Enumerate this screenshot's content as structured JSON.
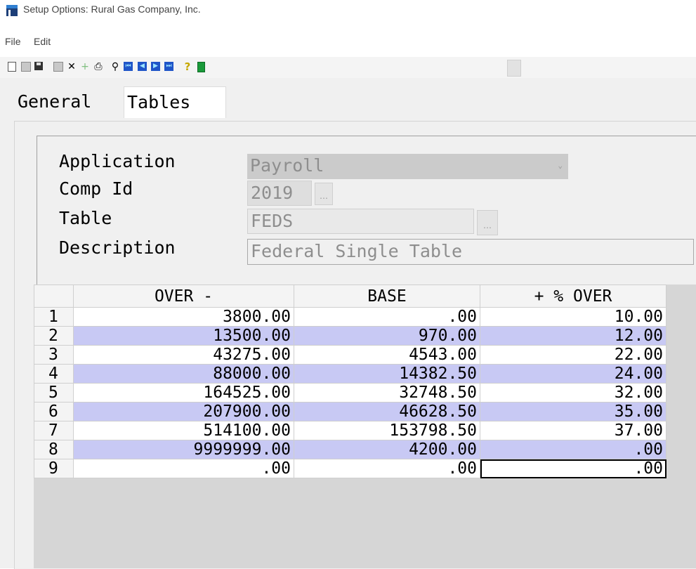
{
  "window": {
    "title": "Setup Options: Rural Gas Company, Inc."
  },
  "menu": {
    "items": [
      "File",
      "Edit"
    ]
  },
  "toolbar": {
    "buttons": [
      "new-icon",
      "copy-icon",
      "save-icon",
      "clear-icon",
      "delete-icon",
      "add-icon",
      "print-icon",
      "find-icon",
      "first-record-icon",
      "previous-record-icon",
      "next-record-icon",
      "last-record-icon",
      "help-icon",
      "exit-icon",
      "options-icon"
    ]
  },
  "tabs": [
    {
      "label": "General",
      "active": false
    },
    {
      "label": "Tables",
      "active": true
    }
  ],
  "form": {
    "application_label": "Application",
    "application_value": "Payroll",
    "compid_label": "Comp Id",
    "compid_value": "2019",
    "table_label": "Table",
    "table_value": "FEDS",
    "description_label": "Description",
    "description_value": "Federal Single Table"
  },
  "grid": {
    "headers": [
      "",
      "OVER -",
      "BASE",
      "+ % OVER"
    ],
    "rows": [
      {
        "n": "1",
        "over": "3800.00",
        "base": ".00",
        "pct": "10.00"
      },
      {
        "n": "2",
        "over": "13500.00",
        "base": "970.00",
        "pct": "12.00"
      },
      {
        "n": "3",
        "over": "43275.00",
        "base": "4543.00",
        "pct": "22.00"
      },
      {
        "n": "4",
        "over": "88000.00",
        "base": "14382.50",
        "pct": "24.00"
      },
      {
        "n": "5",
        "over": "164525.00",
        "base": "32748.50",
        "pct": "32.00"
      },
      {
        "n": "6",
        "over": "207900.00",
        "base": "46628.50",
        "pct": "35.00"
      },
      {
        "n": "7",
        "over": "514100.00",
        "base": "153798.50",
        "pct": "37.00"
      },
      {
        "n": "8",
        "over": "9999999.00",
        "base": "4200.00",
        "pct": ".00"
      },
      {
        "n": "9",
        "over": ".00",
        "base": ".00",
        "pct": ".00"
      }
    ],
    "alt_row_color": "#c8c9f4"
  }
}
